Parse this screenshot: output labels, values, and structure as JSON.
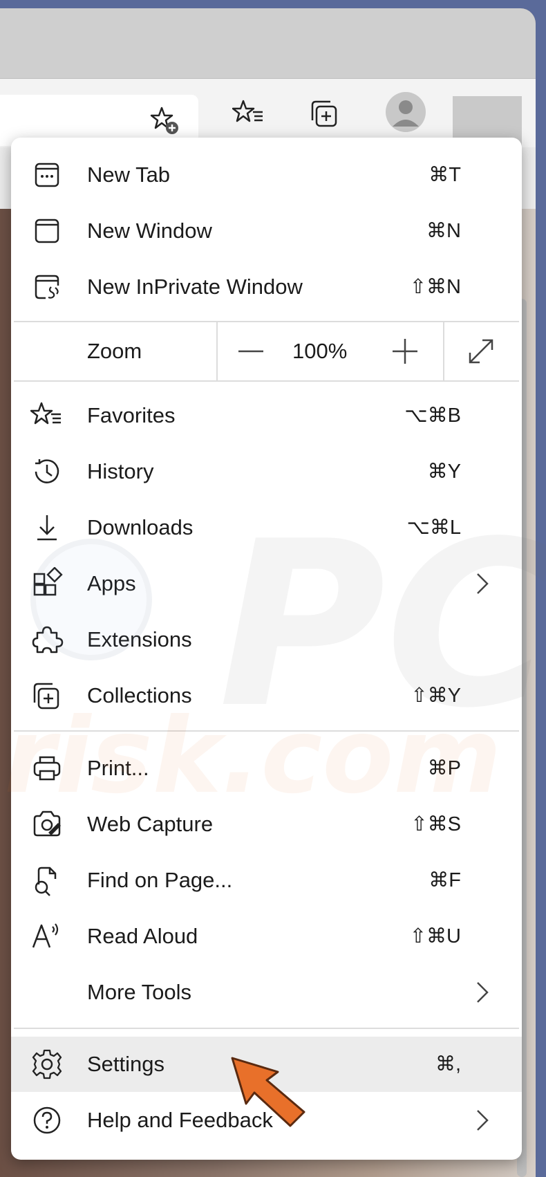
{
  "menu": {
    "items": [
      {
        "label": "New Tab",
        "shortcut": "⌘T",
        "icon": "new-tab-icon"
      },
      {
        "label": "New Window",
        "shortcut": "⌘N",
        "icon": "window-icon"
      },
      {
        "label": "New InPrivate Window",
        "shortcut": "⇧⌘N",
        "icon": "inprivate-window-icon"
      },
      {
        "label": "Favorites",
        "shortcut": "⌥⌘B",
        "icon": "favorites-icon"
      },
      {
        "label": "History",
        "shortcut": "⌘Y",
        "icon": "history-icon"
      },
      {
        "label": "Downloads",
        "shortcut": "⌥⌘L",
        "icon": "download-icon"
      },
      {
        "label": "Apps",
        "shortcut": "",
        "icon": "apps-icon"
      },
      {
        "label": "Extensions",
        "shortcut": "",
        "icon": "extensions-icon"
      },
      {
        "label": "Collections",
        "shortcut": "⇧⌘Y",
        "icon": "collections-icon"
      },
      {
        "label": "Print...",
        "shortcut": "⌘P",
        "icon": "print-icon"
      },
      {
        "label": "Web Capture",
        "shortcut": "⇧⌘S",
        "icon": "web-capture-icon"
      },
      {
        "label": "Find on Page...",
        "shortcut": "⌘F",
        "icon": "find-icon"
      },
      {
        "label": "Read Aloud",
        "shortcut": "⇧⌘U",
        "icon": "read-aloud-icon"
      },
      {
        "label": "More Tools",
        "shortcut": "",
        "icon": ""
      },
      {
        "label": "Settings",
        "shortcut": "⌘,",
        "icon": "gear-icon"
      },
      {
        "label": "Help and Feedback",
        "shortcut": "",
        "icon": "help-icon"
      }
    ],
    "zoom": {
      "label": "Zoom",
      "value": "100%"
    }
  },
  "watermark": {
    "line1": "PC",
    "line2": "risk.com"
  },
  "colors": {
    "accent": "#e8702a",
    "menu_bg": "#ffffff",
    "selected_bg": "#ececec"
  }
}
